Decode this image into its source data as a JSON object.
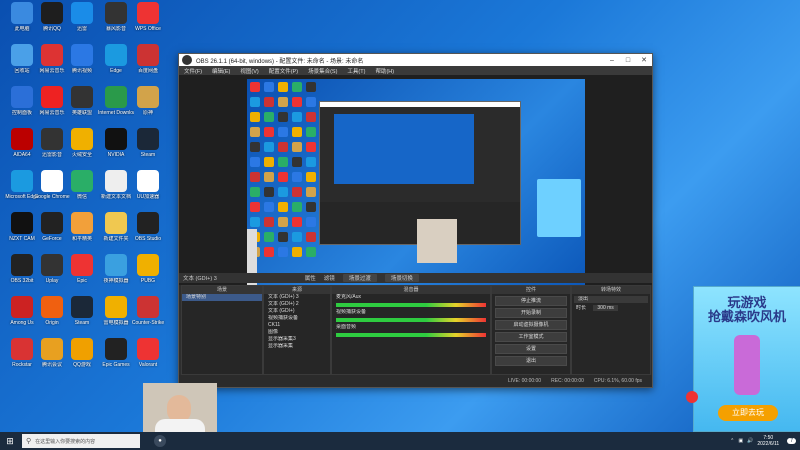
{
  "desktop": {
    "icons": [
      {
        "label": "此电脑",
        "color": "#3a8ae0"
      },
      {
        "label": "腾讯QQ",
        "color": "#1e1e1e"
      },
      {
        "label": "迅雷",
        "color": "#1a8ce8"
      },
      {
        "label": "暴风影音",
        "color": "#333"
      },
      {
        "label": "WPS Office",
        "color": "#e33"
      },
      {
        "label": "回收站",
        "color": "#4aa0e8"
      },
      {
        "label": "网易云音乐",
        "color": "#d33"
      },
      {
        "label": "腾讯视频",
        "color": "#2b78e4"
      },
      {
        "label": "Edge",
        "color": "#1b9ae0"
      },
      {
        "label": "百度网盘",
        "color": "#cc3333"
      },
      {
        "label": "控制面板",
        "color": "#2b6fd8"
      },
      {
        "label": "网易云音乐",
        "color": "#e22"
      },
      {
        "label": "英雄联盟",
        "color": "#333"
      },
      {
        "label": "Internet Download",
        "color": "#2a9a4a"
      },
      {
        "label": "原神",
        "color": "#d2a34a"
      },
      {
        "label": "AIDA64",
        "color": "#b00"
      },
      {
        "label": "迅雷影音",
        "color": "#333"
      },
      {
        "label": "火绒安全",
        "color": "#f0b000"
      },
      {
        "label": "NVIDIA",
        "color": "#111"
      },
      {
        "label": "Steam",
        "color": "#1b2838"
      },
      {
        "label": "Microsoft Edge",
        "color": "#1b9ae0"
      },
      {
        "label": "Google Chrome",
        "color": "#fff"
      },
      {
        "label": "微信",
        "color": "#2aae67"
      },
      {
        "label": "新建文本文档",
        "color": "#eee"
      },
      {
        "label": "UU加速器",
        "color": "#fff"
      },
      {
        "label": "NZXT CAM",
        "color": "#111"
      },
      {
        "label": "GeForce",
        "color": "#222"
      },
      {
        "label": "和平精英",
        "color": "#f2a03a"
      },
      {
        "label": "新建文件夹",
        "color": "#f0c850"
      },
      {
        "label": "OBS Studio",
        "color": "#222"
      },
      {
        "label": "OBS 32bit",
        "color": "#222"
      },
      {
        "label": "Uplay",
        "color": "#333"
      },
      {
        "label": "Epic",
        "color": "#ee3333"
      },
      {
        "label": "夜神模拟器",
        "color": "#3aa0e0"
      },
      {
        "label": "PUBG",
        "color": "#f0b000"
      },
      {
        "label": "Among Us",
        "color": "#cc2222"
      },
      {
        "label": "Origin",
        "color": "#f06010"
      },
      {
        "label": "Steam",
        "color": "#1b2838"
      },
      {
        "label": "雷电模拟器",
        "color": "#f0b000"
      },
      {
        "label": "Counter-Strike",
        "color": "#cc3333"
      },
      {
        "label": "Rockstar",
        "color": "#d93333"
      },
      {
        "label": "腾讯会议",
        "color": "#e8a020"
      },
      {
        "label": "QQ游戏",
        "color": "#f0a000"
      },
      {
        "label": "Epic Games",
        "color": "#222"
      },
      {
        "label": "Valorant",
        "color": "#e33"
      }
    ]
  },
  "obs": {
    "title": "OBS 26.1.1 (64-bit, windows) - 配置文件: 未命名 - 场景: 未命名",
    "menu": [
      "文件(F)",
      "编辑(E)",
      "视图(V)",
      "配置文件(P)",
      "场景集合(S)",
      "工具(T)",
      "帮助(H)"
    ],
    "source_bar": {
      "selected": "文本 (GDI+) 3",
      "properties": "属性",
      "filters": "滤镜",
      "tabs": [
        "场景过渡",
        "场景切换"
      ]
    },
    "docks": {
      "scenes": {
        "title": "场景",
        "items": [
          "场景特别"
        ]
      },
      "sources": {
        "title": "来源",
        "items": [
          "文本 (GDI+) 3",
          "文本 (GDI+) 2",
          "文本 (GDI+)",
          "视频捕获设备",
          "CK11",
          "图像",
          "显示器采集3",
          "显示器采集"
        ]
      },
      "mixer": {
        "title": "混音器",
        "tracks": [
          "麦克风/Aux",
          "视频捕获设备",
          "桌面音频"
        ]
      },
      "controls": {
        "title": "控件",
        "buttons": [
          "停止推流",
          "开始录制",
          "启动虚拟摄像机",
          "工作室模式",
          "设置",
          "退出"
        ]
      },
      "transitions": {
        "title": "转场特效",
        "type": "淡出",
        "duration_label": "时长",
        "duration": "300 ms"
      }
    },
    "status": {
      "live": "LIVE: 00:00:00",
      "rec": "REC: 00:00:00",
      "cpu": "CPU: 6.1%, 60.00 fps"
    }
  },
  "ad": {
    "title_line1": "玩游戏",
    "title_line2": "抢戴森吹风机",
    "button": "立即去玩"
  },
  "taskbar": {
    "search_placeholder": "在这里输入你要搜索的内容",
    "time": "7:50",
    "date": "2022/6/11",
    "notification_count": "7"
  }
}
